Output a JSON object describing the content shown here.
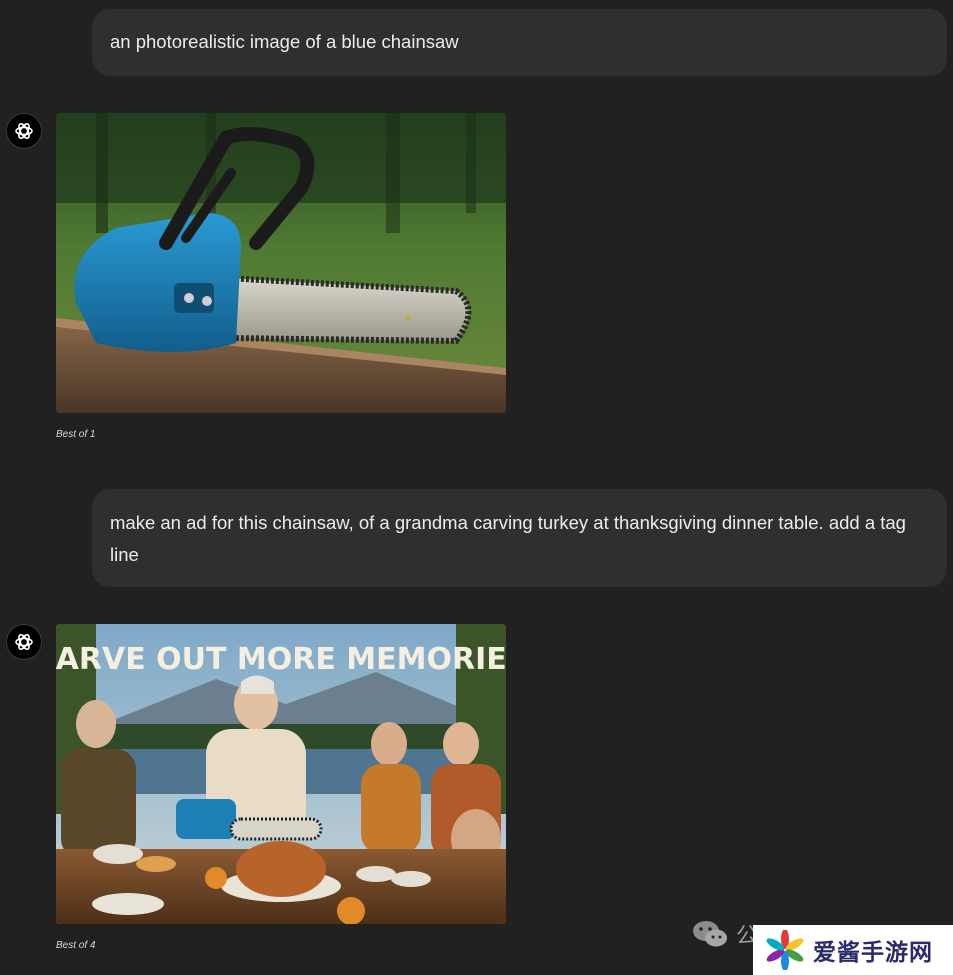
{
  "messages": [
    {
      "role": "user",
      "text": "an photorealistic image of a blue chainsaw"
    },
    {
      "role": "assistant",
      "caption": "Best of 1"
    },
    {
      "role": "user",
      "text": "make an ad for this chainsaw, of a grandma carving turkey at thanksgiving dinner table. add a tag line"
    },
    {
      "role": "assistant",
      "caption": "Best of 4",
      "image_tagline": "CARVE OUT MORE MEMORIES"
    }
  ],
  "watermark": {
    "text": "公",
    "brand": "爱酱手游网"
  },
  "icons": {
    "assistant_avatar": "openai-logo-icon",
    "wechat": "wechat-icon",
    "brand_logo": "pinwheel-logo-icon"
  },
  "colors": {
    "background": "#212121",
    "user_bubble": "#2f2f2f",
    "text": "#ececec",
    "chainsaw_blue": "#1e7fb5"
  }
}
